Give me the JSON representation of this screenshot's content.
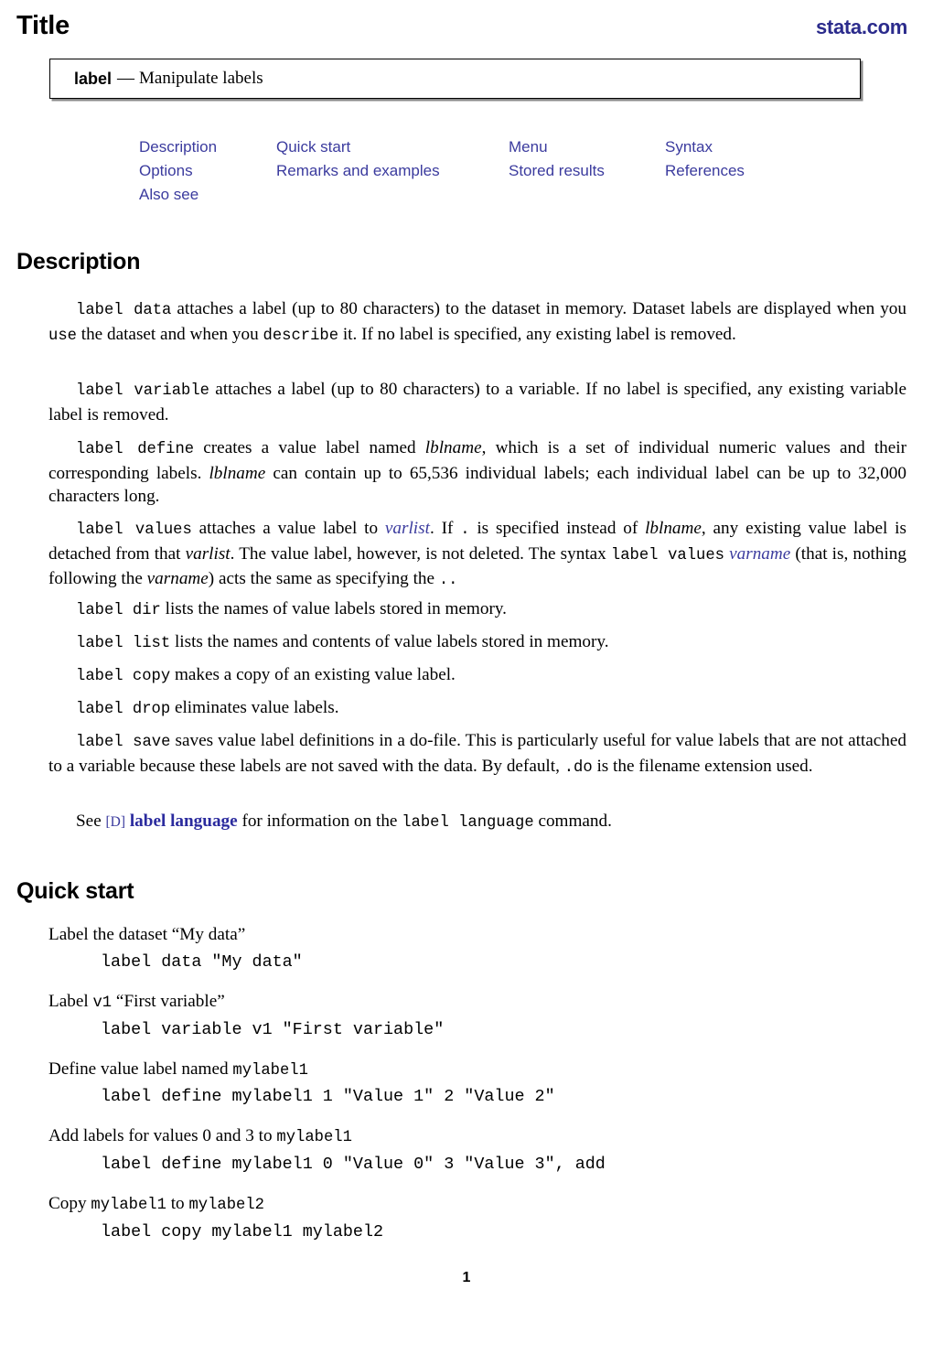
{
  "header": {
    "title": "Title",
    "site_link": "stata.com"
  },
  "title_box": {
    "command": "label",
    "dash": "—",
    "subtitle": "Manipulate labels"
  },
  "nav_links": {
    "row1": [
      "Description",
      "Quick start",
      "Menu",
      "Syntax"
    ],
    "row2": [
      "Options",
      "Remarks and examples",
      "Stored results",
      "References"
    ],
    "row3": [
      "Also see"
    ]
  },
  "sections": {
    "description_heading": "Description",
    "quickstart_heading": "Quick start"
  },
  "description": {
    "p1": {
      "cmd": "label data",
      "t1": " attaches a label (up to 80 characters) to the dataset in memory. Dataset labels are displayed when you ",
      "cmd2": "use",
      "t2": " the dataset and when you ",
      "cmd3": "describe",
      "t3": " it. If no label is specified, any existing label is removed."
    },
    "p2": {
      "cmd": "label variable",
      "t1": " attaches a label (up to 80 characters) to a variable. If no label is specified, any existing variable label is removed."
    },
    "p3": {
      "cmd": "label define",
      "t1": " creates a value label named ",
      "it1": "lblname",
      "t2": ", which is a set of individual numeric values and their corresponding labels. ",
      "it2": "lblname",
      "t3": " can contain up to 65,536 individual labels; each individual label can be up to 32,000 characters long."
    },
    "p4": {
      "cmd": "label values",
      "t1": " attaches a value label to ",
      "link1": "varlist",
      "t2": ". If ",
      "cmd2": ".",
      "t3": " is specified instead of ",
      "it1": "lblname",
      "t4": ", any existing value label is detached from that ",
      "it2": "varlist",
      "t5": ". The value label, however, is not deleted. The syntax ",
      "cmd3": "label values",
      "t6": " ",
      "link2": "varname",
      "t7": " (that is, nothing following the ",
      "it3": "varname",
      "t8": ") acts the same as specifying the ",
      "cmd4": "..",
      "t9": ""
    },
    "p5": {
      "cmd": "label dir",
      "t1": " lists the names of value labels stored in memory."
    },
    "p6": {
      "cmd": "label list",
      "t1": " lists the names and contents of value labels stored in memory."
    },
    "p7": {
      "cmd": "label copy",
      "t1": " makes a copy of an existing value label."
    },
    "p8": {
      "cmd": "label drop",
      "t1": " eliminates value labels."
    },
    "p9": {
      "cmd": "label save",
      "t1": " saves value label definitions in a do-file. This is particularly useful for value labels that are not attached to a variable because these labels are not saved with the data. By default, ",
      "cmd2": ".do",
      "t2": " is the filename extension used."
    },
    "p10": {
      "t1": "See ",
      "bracket": "[D]",
      "t2": " ",
      "link": "label language",
      "t3": " for information on the ",
      "cmd": "label language",
      "t4": " command."
    }
  },
  "quickstart": {
    "items": [
      {
        "label_pre": "Label the dataset ",
        "label_quoted": "“My data”",
        "label_post": "",
        "code": "label data \"My data\""
      },
      {
        "label_pre": "Label ",
        "label_code": "v1",
        "label_quoted": " “First variable”",
        "code": "label variable v1 \"First variable\""
      },
      {
        "label_pre": "Define value label named ",
        "label_code": "mylabel1",
        "code": "label define mylabel1 1 \"Value 1\" 2 \"Value 2\""
      },
      {
        "label_pre": "Add labels for values 0 and 3 to ",
        "label_code": "mylabel1",
        "code": "label define mylabel1 0 \"Value 0\" 3 \"Value 3\", add"
      },
      {
        "label_pre": "Copy ",
        "label_code": "mylabel1",
        "label_mid": " to ",
        "label_code2": "mylabel2",
        "code": "label copy mylabel1 mylabel2"
      }
    ]
  },
  "footer": {
    "page_number": "1"
  },
  "colors": {
    "link_blue": "#3b3b9e",
    "logo_navy": "#2b2b8c",
    "text_black": "#000000",
    "box_shadow": "#8a8a8a"
  }
}
